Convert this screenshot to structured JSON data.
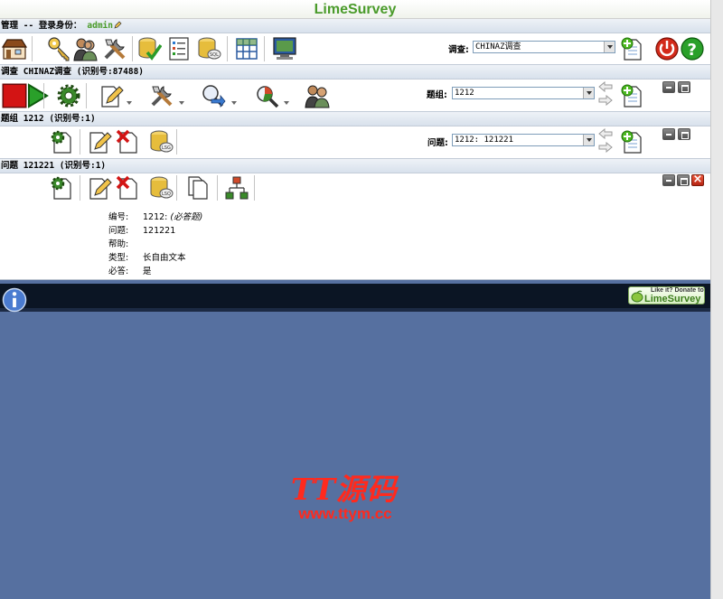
{
  "app": {
    "title": "LimeSurvey"
  },
  "admin_bar": {
    "label": "管理 -- 登录身份：",
    "username": "admin"
  },
  "admin_tools": {
    "survey_select_label": "调查:",
    "survey_select_value": "CHINAZ调查",
    "icons": [
      "home-icon",
      "keys-icon",
      "user-groups-icon",
      "global-settings-icon",
      "check-data-icon",
      "template-editor-icon",
      "backup-database-icon",
      "labels-grid-icon",
      "template-screen-icon",
      "add-survey-icon",
      "logout-icon",
      "help-icon"
    ]
  },
  "survey_bar": {
    "label": "调查 CHINAZ调查 (识别号:87488)"
  },
  "survey_tools": {
    "group_select_label": "题组:",
    "group_select_value": "1212",
    "icons": [
      "stop-survey-icon",
      "activate-icon",
      "survey-settings-icon",
      "edit-survey-icon",
      "tools-icon",
      "export-icon",
      "browse-responses-icon",
      "participants-icon",
      "add-group-icon"
    ]
  },
  "group_bar": {
    "label": "题组 1212 (识别号:1)"
  },
  "group_tools": {
    "question_select_label": "问题:",
    "question_select_value": "1212: 121221",
    "icons": [
      "group-settings-icon",
      "edit-group-icon",
      "delete-group-icon",
      "export-group-icon",
      "add-question-icon"
    ]
  },
  "question_bar": {
    "label": "问题 121221 (识别号:1)"
  },
  "question_tools": {
    "icons": [
      "question-settings-icon",
      "edit-question-icon",
      "delete-question-icon",
      "export-question-icon",
      "copy-question-icon",
      "conditions-icon"
    ]
  },
  "question_details": [
    {
      "key": "编号:",
      "value": "1212:",
      "note": "(必答题)"
    },
    {
      "key": "问题:",
      "value": "121221",
      "note": ""
    },
    {
      "key": "帮助:",
      "value": "",
      "note": ""
    },
    {
      "key": "类型:",
      "value": "长自由文本",
      "note": ""
    },
    {
      "key": "必答:",
      "value": "是",
      "note": ""
    }
  ],
  "footer": {
    "donate_line1": "Like it? Donate to",
    "donate_line2": "LimeSurvey"
  },
  "watermark": {
    "line1": "TT源码",
    "line2": "www.ttym.cc"
  },
  "colors": {
    "brand": "#4a9b2a",
    "background": "#5670a0",
    "footer": "#0b1524",
    "watermark": "#ff2a1e"
  }
}
